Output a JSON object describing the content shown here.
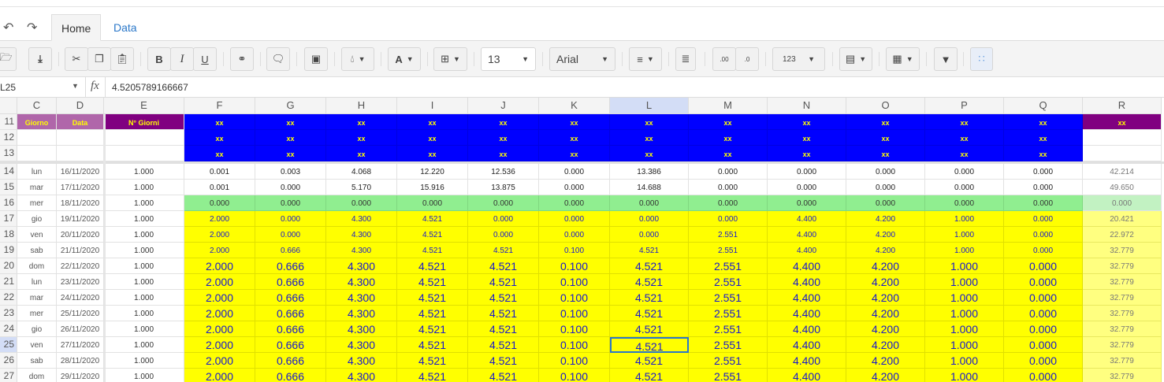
{
  "tabs": [
    {
      "label": "Home",
      "active": true
    },
    {
      "label": "Data",
      "active": false
    }
  ],
  "toolbar": {
    "font_size": "13",
    "font_family": "Arial",
    "number_format": "123"
  },
  "formula_bar": {
    "cell_ref": "L25",
    "fx": "fx",
    "value": "4.5205789166667"
  },
  "columns": [
    "C",
    "D",
    "E",
    "F",
    "G",
    "H",
    "I",
    "J",
    "K",
    "L",
    "M",
    "N",
    "O",
    "P",
    "Q",
    "R"
  ],
  "selected_column": "L",
  "selected_row": "25",
  "header_rows": {
    "numbers": [
      "11",
      "12",
      "13"
    ],
    "labels": {
      "C": "Giorno",
      "D": "Data",
      "E": "N° Giorni",
      "R": "xx"
    },
    "placeholder": "xx"
  },
  "colors": {
    "blue_fill": "#0000ff",
    "yellow_fill": "#ffff00",
    "green_fill": "#90ee90",
    "purple": "#800080",
    "light_purple": "#b066aa",
    "header_text": "#ffff00",
    "value_text": "#1a1acc",
    "selection": "#2a77c9"
  },
  "rows": [
    {
      "n": "14",
      "style": "white",
      "day": "lun",
      "date": "16/11/2020",
      "e": "1.000",
      "v": [
        "0.001",
        "0.003",
        "4.068",
        "12.220",
        "12.536",
        "0.000",
        "13.386",
        "0.000",
        "0.000",
        "0.000",
        "0.000",
        "0.000"
      ],
      "r": "42.214"
    },
    {
      "n": "15",
      "style": "white",
      "day": "mar",
      "date": "17/11/2020",
      "e": "1.000",
      "v": [
        "0.001",
        "0.000",
        "5.170",
        "15.916",
        "13.875",
        "0.000",
        "14.688",
        "0.000",
        "0.000",
        "0.000",
        "0.000",
        "0.000"
      ],
      "r": "49.650"
    },
    {
      "n": "16",
      "style": "green",
      "day": "mer",
      "date": "18/11/2020",
      "e": "1.000",
      "v": [
        "0.000",
        "0.000",
        "0.000",
        "0.000",
        "0.000",
        "0.000",
        "0.000",
        "0.000",
        "0.000",
        "0.000",
        "0.000",
        "0.000"
      ],
      "r": "0.000"
    },
    {
      "n": "17",
      "style": "yellow-small",
      "day": "gio",
      "date": "19/11/2020",
      "e": "1.000",
      "v": [
        "2.000",
        "0.000",
        "4.300",
        "4.521",
        "0.000",
        "0.000",
        "0.000",
        "0.000",
        "4.400",
        "4.200",
        "1.000",
        "0.000"
      ],
      "r": "20.421"
    },
    {
      "n": "18",
      "style": "yellow-small",
      "day": "ven",
      "date": "20/11/2020",
      "e": "1.000",
      "v": [
        "2.000",
        "0.000",
        "4.300",
        "4.521",
        "0.000",
        "0.000",
        "0.000",
        "2.551",
        "4.400",
        "4.200",
        "1.000",
        "0.000"
      ],
      "r": "22.972"
    },
    {
      "n": "19",
      "style": "yellow-small",
      "day": "sab",
      "date": "21/11/2020",
      "e": "1.000",
      "v": [
        "2.000",
        "0.666",
        "4.300",
        "4.521",
        "4.521",
        "0.100",
        "4.521",
        "2.551",
        "4.400",
        "4.200",
        "1.000",
        "0.000"
      ],
      "r": "32.779"
    },
    {
      "n": "20",
      "style": "yellow-large",
      "day": "dom",
      "date": "22/11/2020",
      "e": "1.000",
      "v": [
        "2.000",
        "0.666",
        "4.300",
        "4.521",
        "4.521",
        "0.100",
        "4.521",
        "2.551",
        "4.400",
        "4.200",
        "1.000",
        "0.000"
      ],
      "r": "32.779"
    },
    {
      "n": "21",
      "style": "yellow-large",
      "day": "lun",
      "date": "23/11/2020",
      "e": "1.000",
      "v": [
        "2.000",
        "0.666",
        "4.300",
        "4.521",
        "4.521",
        "0.100",
        "4.521",
        "2.551",
        "4.400",
        "4.200",
        "1.000",
        "0.000"
      ],
      "r": "32.779"
    },
    {
      "n": "22",
      "style": "yellow-large",
      "day": "mar",
      "date": "24/11/2020",
      "e": "1.000",
      "v": [
        "2.000",
        "0.666",
        "4.300",
        "4.521",
        "4.521",
        "0.100",
        "4.521",
        "2.551",
        "4.400",
        "4.200",
        "1.000",
        "0.000"
      ],
      "r": "32.779"
    },
    {
      "n": "23",
      "style": "yellow-large",
      "day": "mer",
      "date": "25/11/2020",
      "e": "1.000",
      "v": [
        "2.000",
        "0.666",
        "4.300",
        "4.521",
        "4.521",
        "0.100",
        "4.521",
        "2.551",
        "4.400",
        "4.200",
        "1.000",
        "0.000"
      ],
      "r": "32.779"
    },
    {
      "n": "24",
      "style": "yellow-large",
      "day": "gio",
      "date": "26/11/2020",
      "e": "1.000",
      "v": [
        "2.000",
        "0.666",
        "4.300",
        "4.521",
        "4.521",
        "0.100",
        "4.521",
        "2.551",
        "4.400",
        "4.200",
        "1.000",
        "0.000"
      ],
      "r": "32.779"
    },
    {
      "n": "25",
      "style": "yellow-large",
      "day": "ven",
      "date": "27/11/2020",
      "e": "1.000",
      "v": [
        "2.000",
        "0.666",
        "4.300",
        "4.521",
        "4.521",
        "0.100",
        "4.521",
        "2.551",
        "4.400",
        "4.200",
        "1.000",
        "0.000"
      ],
      "r": "32.779"
    },
    {
      "n": "26",
      "style": "yellow-large",
      "day": "sab",
      "date": "28/11/2020",
      "e": "1.000",
      "v": [
        "2.000",
        "0.666",
        "4.300",
        "4.521",
        "4.521",
        "0.100",
        "4.521",
        "2.551",
        "4.400",
        "4.200",
        "1.000",
        "0.000"
      ],
      "r": "32.779"
    },
    {
      "n": "27",
      "style": "yellow-large",
      "day": "dom",
      "date": "29/11/2020",
      "e": "1.000",
      "v": [
        "2.000",
        "0.666",
        "4.300",
        "4.521",
        "4.521",
        "0.100",
        "4.521",
        "2.551",
        "4.400",
        "4.200",
        "1.000",
        "0.000"
      ],
      "r": "32.779"
    }
  ]
}
